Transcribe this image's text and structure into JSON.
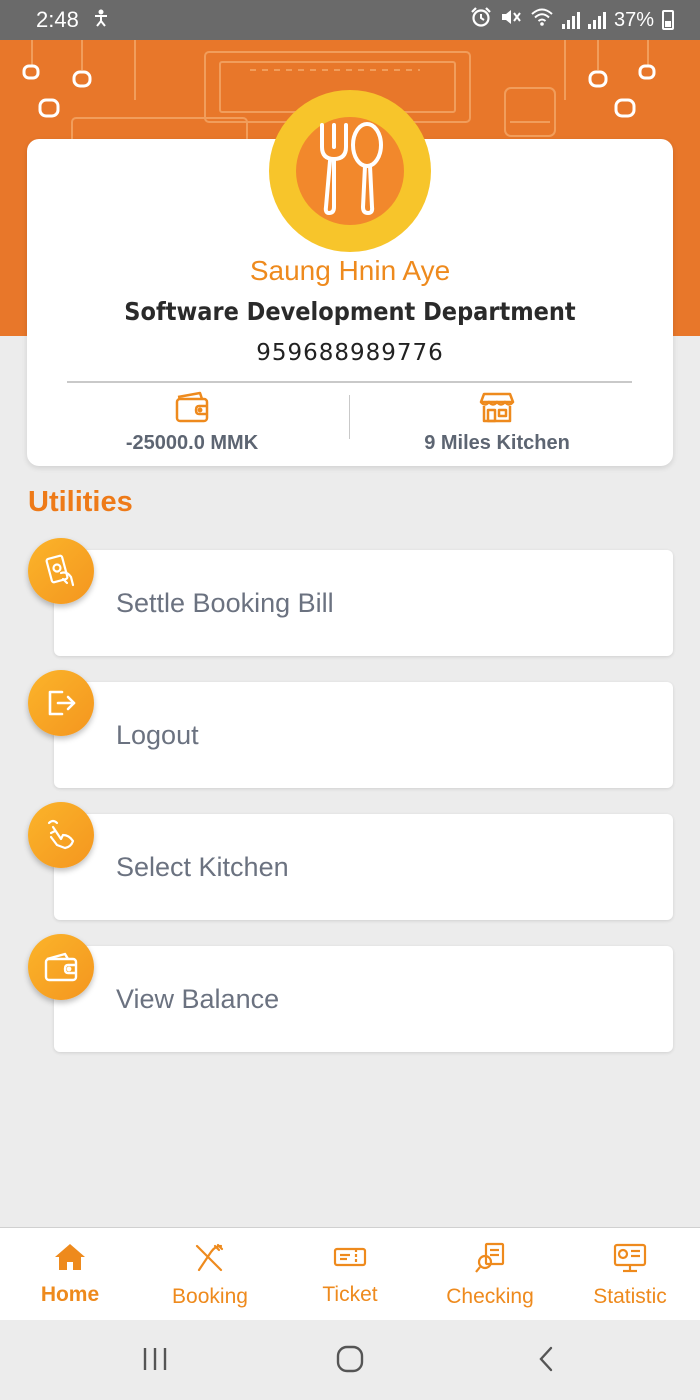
{
  "status_bar": {
    "time": "2:48",
    "battery": "37%",
    "icons": [
      "accessibility-icon",
      "alarm-icon",
      "mute-icon",
      "wifi-icon",
      "signal-icon",
      "battery-icon"
    ]
  },
  "profile": {
    "name": "Saung Hnin Aye",
    "department": "Software Development Department",
    "phone": "959688989776",
    "balance": "-25000.0 MMK",
    "kitchen": "9 Miles Kitchen",
    "avatar_icon": "fork-spoon-icon"
  },
  "utilities": {
    "title": "Utilities",
    "items": [
      {
        "label": "Settle Booking Bill",
        "icon": "cash-hand-icon"
      },
      {
        "label": "Logout",
        "icon": "logout-icon"
      },
      {
        "label": "Select Kitchen",
        "icon": "hand-pointer-icon"
      },
      {
        "label": "View Balance",
        "icon": "wallet-icon"
      }
    ]
  },
  "bottom_nav": {
    "active": "Home",
    "items": [
      {
        "label": "Home",
        "icon": "home-icon"
      },
      {
        "label": "Booking",
        "icon": "fork-knife-icon"
      },
      {
        "label": "Ticket",
        "icon": "ticket-icon"
      },
      {
        "label": "Checking",
        "icon": "checking-icon"
      },
      {
        "label": "Statistic",
        "icon": "statistic-icon"
      }
    ]
  },
  "colors": {
    "accent": "#ee8a1d",
    "banner": "#e8772a",
    "avatar_outer": "#f7c52b",
    "avatar_inner": "#f2882c",
    "label_gray": "#6b7280"
  }
}
